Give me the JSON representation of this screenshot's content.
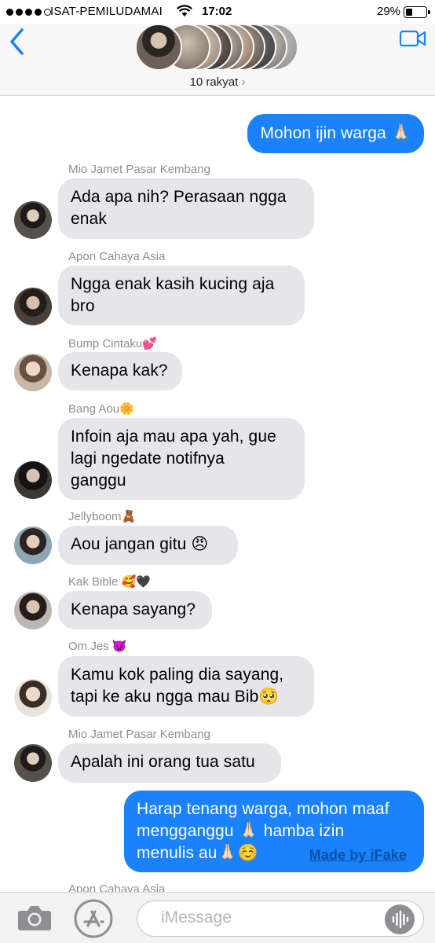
{
  "status_bar": {
    "carrier": "ISAT-PEMILUDAMAI",
    "time": "17:02",
    "battery": "29%"
  },
  "header": {
    "group_name": "10 rakyat",
    "chevron": "›",
    "back_icon": "chevron-left-icon",
    "video_icon": "video-camera-icon"
  },
  "messages": [
    {
      "dir": "out",
      "text": "Mohon ijin warga 🙏🏻"
    },
    {
      "dir": "in",
      "sender": "Mio Jamet Pasar Kembang",
      "lines": [
        "Ada apa nih? Perasaan ngga",
        "enak"
      ]
    },
    {
      "dir": "in",
      "sender": "Apon Cahaya Asia",
      "lines": [
        "Ngga enak kasih kucing aja",
        "bro"
      ]
    },
    {
      "dir": "in",
      "sender": "Bump Cintaku💕",
      "lines": [
        "Kenapa kak?"
      ]
    },
    {
      "dir": "in",
      "sender": "Bang Aou🌼",
      "lines": [
        "Infoin aja mau apa yah, gue",
        "lagi ngedate notifnya",
        "ganggu"
      ]
    },
    {
      "dir": "in",
      "sender": "Jellyboom🧸",
      "lines": [
        "Aou jangan gitu 😠"
      ]
    },
    {
      "dir": "in",
      "sender": "Kak Bible 🥰🖤",
      "lines": [
        "Kenapa sayang?"
      ]
    },
    {
      "dir": "in",
      "sender": "Om Jes 👿",
      "lines": [
        "Kamu kok paling dia sayang,",
        "tapi ke aku ngga mau Bib🥺"
      ]
    },
    {
      "dir": "in",
      "sender": "Mio Jamet Pasar Kembang",
      "lines": [
        "Apalah ini orang tua satu"
      ]
    },
    {
      "dir": "out",
      "lines": [
        "Harap tenang warga, mohon maaf",
        "mengganggu 🙏🏻 hamba izin",
        "menulis au🙏🏻☺️"
      ]
    },
    {
      "dir": "in",
      "sender": "Apon Cahaya Asia",
      "lines": []
    }
  ],
  "watermark": "Made by iFake",
  "bottom_bar": {
    "placeholder": "iMessage",
    "camera_icon": "camera-icon",
    "apps_icon": "app-store-icon",
    "audio_icon": "audio-waveform-icon"
  },
  "colors": {
    "outgoing_bubble": "#1a82fb",
    "incoming_bubble": "#e5e5ea",
    "accent": "#1a82fb"
  }
}
